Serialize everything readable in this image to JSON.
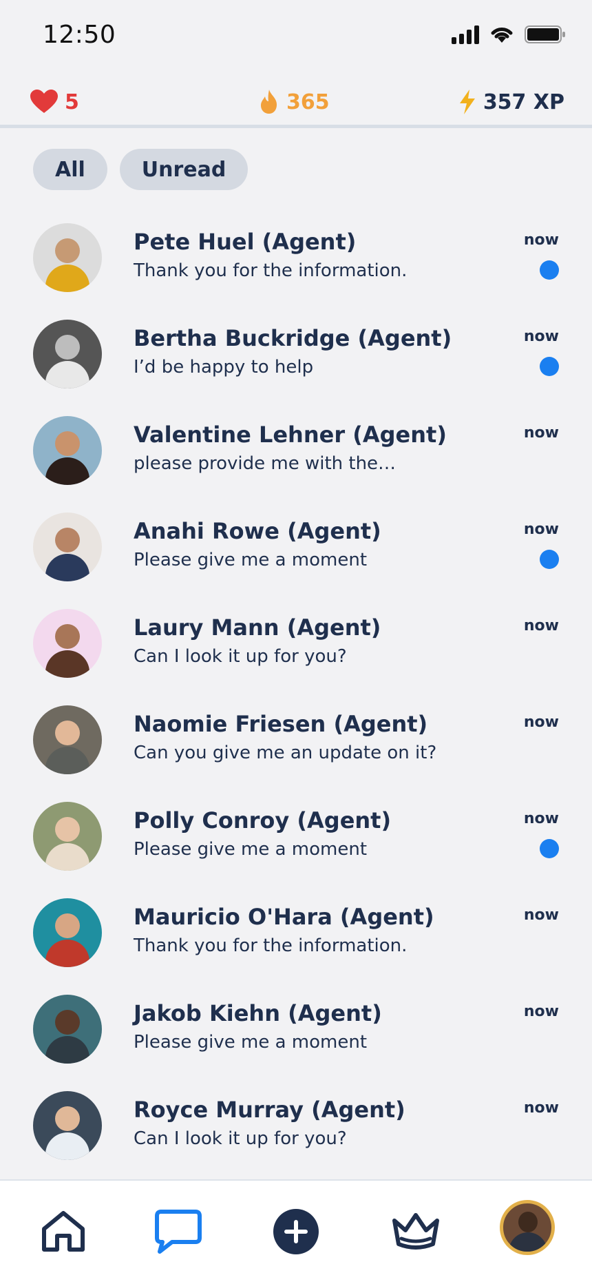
{
  "status_bar": {
    "time": "12:50"
  },
  "stats": {
    "hearts": "5",
    "streak": "365",
    "xp": "357 XP",
    "colors": {
      "hearts": "#e23a3a",
      "streak": "#f2a03a",
      "xp": "#1f2f4d"
    }
  },
  "filters": {
    "all": "All",
    "unread": "Unread"
  },
  "conversations": [
    {
      "name": "Pete Huel (Agent)",
      "preview": "Thank you for the information.",
      "time": "now",
      "unread": true,
      "avatar_bg": "#dcdcdc",
      "skin": "#c69a74",
      "shirt": "#e0a81a"
    },
    {
      "name": "Bertha Buckridge (Agent)",
      "preview": "I’d be happy to help",
      "time": "now",
      "unread": true,
      "avatar_bg": "#555555",
      "skin": "#bdbdbd",
      "shirt": "#e8e8e8"
    },
    {
      "name": "Valentine Lehner (Agent)",
      "preview": "please provide me with the…",
      "time": "now",
      "unread": false,
      "avatar_bg": "#8fb3c9",
      "skin": "#c9936c",
      "shirt": "#2b1e1a"
    },
    {
      "name": "Anahi Rowe (Agent)",
      "preview": "Please give me a moment",
      "time": "now",
      "unread": true,
      "avatar_bg": "#e9e4e0",
      "skin": "#b88566",
      "shirt": "#2a3a5c"
    },
    {
      "name": "Laury Mann (Agent)",
      "preview": "Can I look it up for you?",
      "time": "now",
      "unread": false,
      "avatar_bg": "#f3d9ee",
      "skin": "#a87658",
      "shirt": "#5a3626"
    },
    {
      "name": "Naomie Friesen (Agent)",
      "preview": "Can you give me an update on it?",
      "time": "now",
      "unread": false,
      "avatar_bg": "#6f6a60",
      "skin": "#e2b898",
      "shirt": "#5b5e5a"
    },
    {
      "name": "Polly Conroy (Agent)",
      "preview": "Please give me a moment",
      "time": "now",
      "unread": true,
      "avatar_bg": "#8e9a72",
      "skin": "#e6c3a6",
      "shirt": "#e9dccb"
    },
    {
      "name": "Mauricio O'Hara (Agent)",
      "preview": "Thank you for the information.",
      "time": "now",
      "unread": false,
      "avatar_bg": "#1f8fa0",
      "skin": "#d7a684",
      "shirt": "#c0392b"
    },
    {
      "name": "Jakob Kiehn (Agent)",
      "preview": "Please give me a moment",
      "time": "now",
      "unread": false,
      "avatar_bg": "#3e6f79",
      "skin": "#5a3a2a",
      "shirt": "#2e3b44"
    },
    {
      "name": "Royce Murray (Agent)",
      "preview": "Can I look it up for you?",
      "time": "now",
      "unread": false,
      "avatar_bg": "#3b4a5a",
      "skin": "#e0b898",
      "shirt": "#e9eef3"
    }
  ],
  "icons": {
    "home": "home-icon",
    "chat": "chat-bubble-icon",
    "add": "add-icon",
    "crown": "crown-icon",
    "profile": "profile-avatar"
  },
  "colors": {
    "accent": "#1a7ff0",
    "navy": "#1f2f4d",
    "unread_dot": "#1a7ff0"
  }
}
